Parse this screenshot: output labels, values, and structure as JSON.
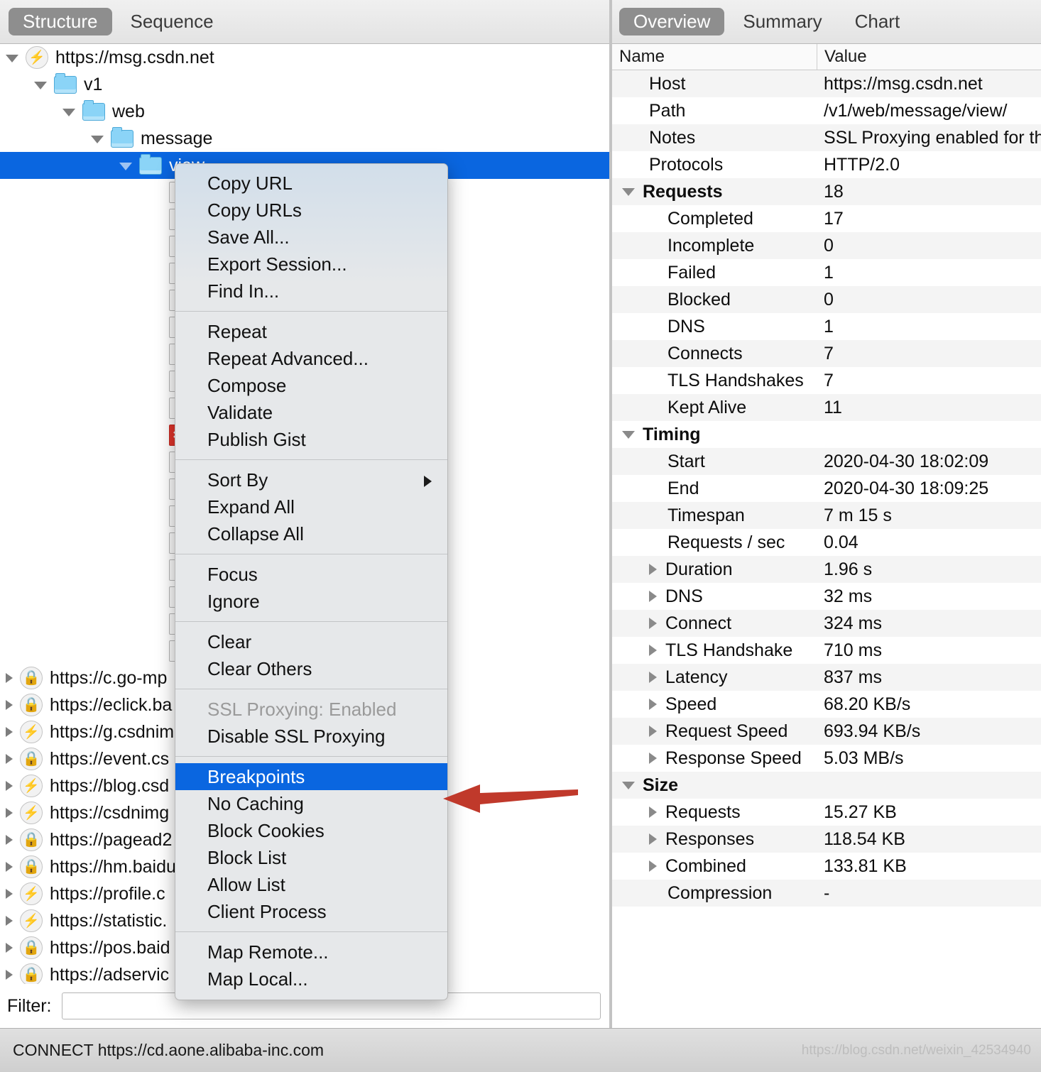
{
  "left_tabs": [
    {
      "label": "Structure",
      "active": true
    },
    {
      "label": "Sequence",
      "active": false
    }
  ],
  "right_tabs": [
    {
      "label": "Overview",
      "active": true
    },
    {
      "label": "Summary",
      "active": false
    },
    {
      "label": "Chart",
      "active": false
    }
  ],
  "tree": [
    {
      "label": "https://msg.csdn.net",
      "icon": "bolt",
      "depth": 0,
      "selected": false
    },
    {
      "label": "v1",
      "icon": "folder",
      "depth": 1,
      "selected": false
    },
    {
      "label": "web",
      "icon": "folder",
      "depth": 2,
      "selected": false
    },
    {
      "label": "message",
      "icon": "folder",
      "depth": 3,
      "selected": false
    },
    {
      "label": "view",
      "icon": "folder",
      "depth": 4,
      "selected": true
    }
  ],
  "hosts": [
    {
      "label": "https://c.go-mp",
      "icon": "lock-gold"
    },
    {
      "label": "https://eclick.ba",
      "icon": "lock-gold"
    },
    {
      "label": "https://g.csdnim",
      "icon": "bolt-dim"
    },
    {
      "label": "https://event.cs",
      "icon": "lock-gold"
    },
    {
      "label": "https://blog.csd",
      "icon": "bolt"
    },
    {
      "label": "https://csdnimg",
      "icon": "bolt-dim"
    },
    {
      "label": "https://pagead2",
      "icon": "lock-gold"
    },
    {
      "label": "https://hm.baidu",
      "icon": "lock-gold"
    },
    {
      "label": "https://profile.c",
      "icon": "bolt-dim"
    },
    {
      "label": "https://statistic.",
      "icon": "bolt-dim"
    },
    {
      "label": "https://pos.baid",
      "icon": "lock-gold"
    },
    {
      "label": "https://adservic",
      "icon": "lock-gold"
    }
  ],
  "filter": {
    "label": "Filter:",
    "value": "",
    "placeholder": ""
  },
  "statusbar": {
    "text": "CONNECT https://cd.aone.alibaba-inc.com",
    "watermark": "https://blog.csdn.net/weixin_42534940"
  },
  "overview": {
    "columns": {
      "name": "Name",
      "value": "Value"
    },
    "rows": [
      {
        "name": "Host",
        "value": "https://msg.csdn.net",
        "kind": "leaf"
      },
      {
        "name": "Path",
        "value": "/v1/web/message/view/",
        "kind": "leaf"
      },
      {
        "name": "Notes",
        "value": "SSL Proxying enabled for th",
        "kind": "leaf"
      },
      {
        "name": "Protocols",
        "value": "HTTP/2.0",
        "kind": "leaf"
      },
      {
        "name": "Requests",
        "value": "18",
        "kind": "group-open"
      },
      {
        "name": "Completed",
        "value": "17",
        "kind": "child"
      },
      {
        "name": "Incomplete",
        "value": "0",
        "kind": "child"
      },
      {
        "name": "Failed",
        "value": "1",
        "kind": "child"
      },
      {
        "name": "Blocked",
        "value": "0",
        "kind": "child"
      },
      {
        "name": "DNS",
        "value": "1",
        "kind": "child"
      },
      {
        "name": "Connects",
        "value": "7",
        "kind": "child"
      },
      {
        "name": "TLS Handshakes",
        "value": "7",
        "kind": "child"
      },
      {
        "name": "Kept Alive",
        "value": "11",
        "kind": "child"
      },
      {
        "name": "Timing",
        "value": "",
        "kind": "group-open"
      },
      {
        "name": "Start",
        "value": "2020-04-30 18:02:09",
        "kind": "child"
      },
      {
        "name": "End",
        "value": "2020-04-30 18:09:25",
        "kind": "child"
      },
      {
        "name": "Timespan",
        "value": "7 m 15 s",
        "kind": "child"
      },
      {
        "name": "Requests / sec",
        "value": "0.04",
        "kind": "child"
      },
      {
        "name": "Duration",
        "value": "1.96 s",
        "kind": "child-closed"
      },
      {
        "name": "DNS",
        "value": "32 ms",
        "kind": "child-closed"
      },
      {
        "name": "Connect",
        "value": "324 ms",
        "kind": "child-closed"
      },
      {
        "name": "TLS Handshake",
        "value": "710 ms",
        "kind": "child-closed"
      },
      {
        "name": "Latency",
        "value": "837 ms",
        "kind": "child-closed"
      },
      {
        "name": "Speed",
        "value": "68.20 KB/s",
        "kind": "child-closed"
      },
      {
        "name": "Request Speed",
        "value": "693.94 KB/s",
        "kind": "child-closed"
      },
      {
        "name": "Response Speed",
        "value": "5.03 MB/s",
        "kind": "child-closed"
      },
      {
        "name": "Size",
        "value": "",
        "kind": "group-open"
      },
      {
        "name": "Requests",
        "value": "15.27 KB",
        "kind": "child-closed"
      },
      {
        "name": "Responses",
        "value": "118.54 KB",
        "kind": "child-closed"
      },
      {
        "name": "Combined",
        "value": "133.81 KB",
        "kind": "child-closed"
      },
      {
        "name": "Compression",
        "value": "-",
        "kind": "child"
      }
    ]
  },
  "context_menu": {
    "items": [
      {
        "label": "Copy URL",
        "type": "item"
      },
      {
        "label": "Copy URLs",
        "type": "item"
      },
      {
        "label": "Save All...",
        "type": "item"
      },
      {
        "label": "Export Session...",
        "type": "item"
      },
      {
        "label": "Find In...",
        "type": "item"
      },
      {
        "type": "separator"
      },
      {
        "label": "Repeat",
        "type": "item"
      },
      {
        "label": "Repeat Advanced...",
        "type": "item"
      },
      {
        "label": "Compose",
        "type": "item"
      },
      {
        "label": "Validate",
        "type": "item"
      },
      {
        "label": "Publish Gist",
        "type": "item"
      },
      {
        "type": "separator"
      },
      {
        "label": "Sort By",
        "type": "submenu"
      },
      {
        "label": "Expand All",
        "type": "item"
      },
      {
        "label": "Collapse All",
        "type": "item"
      },
      {
        "type": "separator"
      },
      {
        "label": "Focus",
        "type": "item"
      },
      {
        "label": "Ignore",
        "type": "item"
      },
      {
        "type": "separator"
      },
      {
        "label": "Clear",
        "type": "item"
      },
      {
        "label": "Clear Others",
        "type": "item"
      },
      {
        "type": "separator"
      },
      {
        "label": "SSL Proxying: Enabled",
        "type": "disabled"
      },
      {
        "label": "Disable SSL Proxying",
        "type": "item"
      },
      {
        "type": "separator"
      },
      {
        "label": "Breakpoints",
        "type": "highlighted"
      },
      {
        "label": "No Caching",
        "type": "item"
      },
      {
        "label": "Block Cookies",
        "type": "item"
      },
      {
        "label": "Block List",
        "type": "item"
      },
      {
        "label": "Allow List",
        "type": "item"
      },
      {
        "label": "Client Process",
        "type": "item"
      },
      {
        "type": "separator"
      },
      {
        "label": "Map Remote...",
        "type": "item"
      },
      {
        "label": "Map Local...",
        "type": "item"
      }
    ]
  },
  "annotation": {
    "arrow_color": "#c0392b",
    "points_to": "Breakpoints"
  },
  "colors": {
    "selection_blue": "#0a66e0",
    "tab_active_gray": "#8e8e8e",
    "folder_blue": "#8bd4f7",
    "arrow_red": "#c0392b"
  }
}
